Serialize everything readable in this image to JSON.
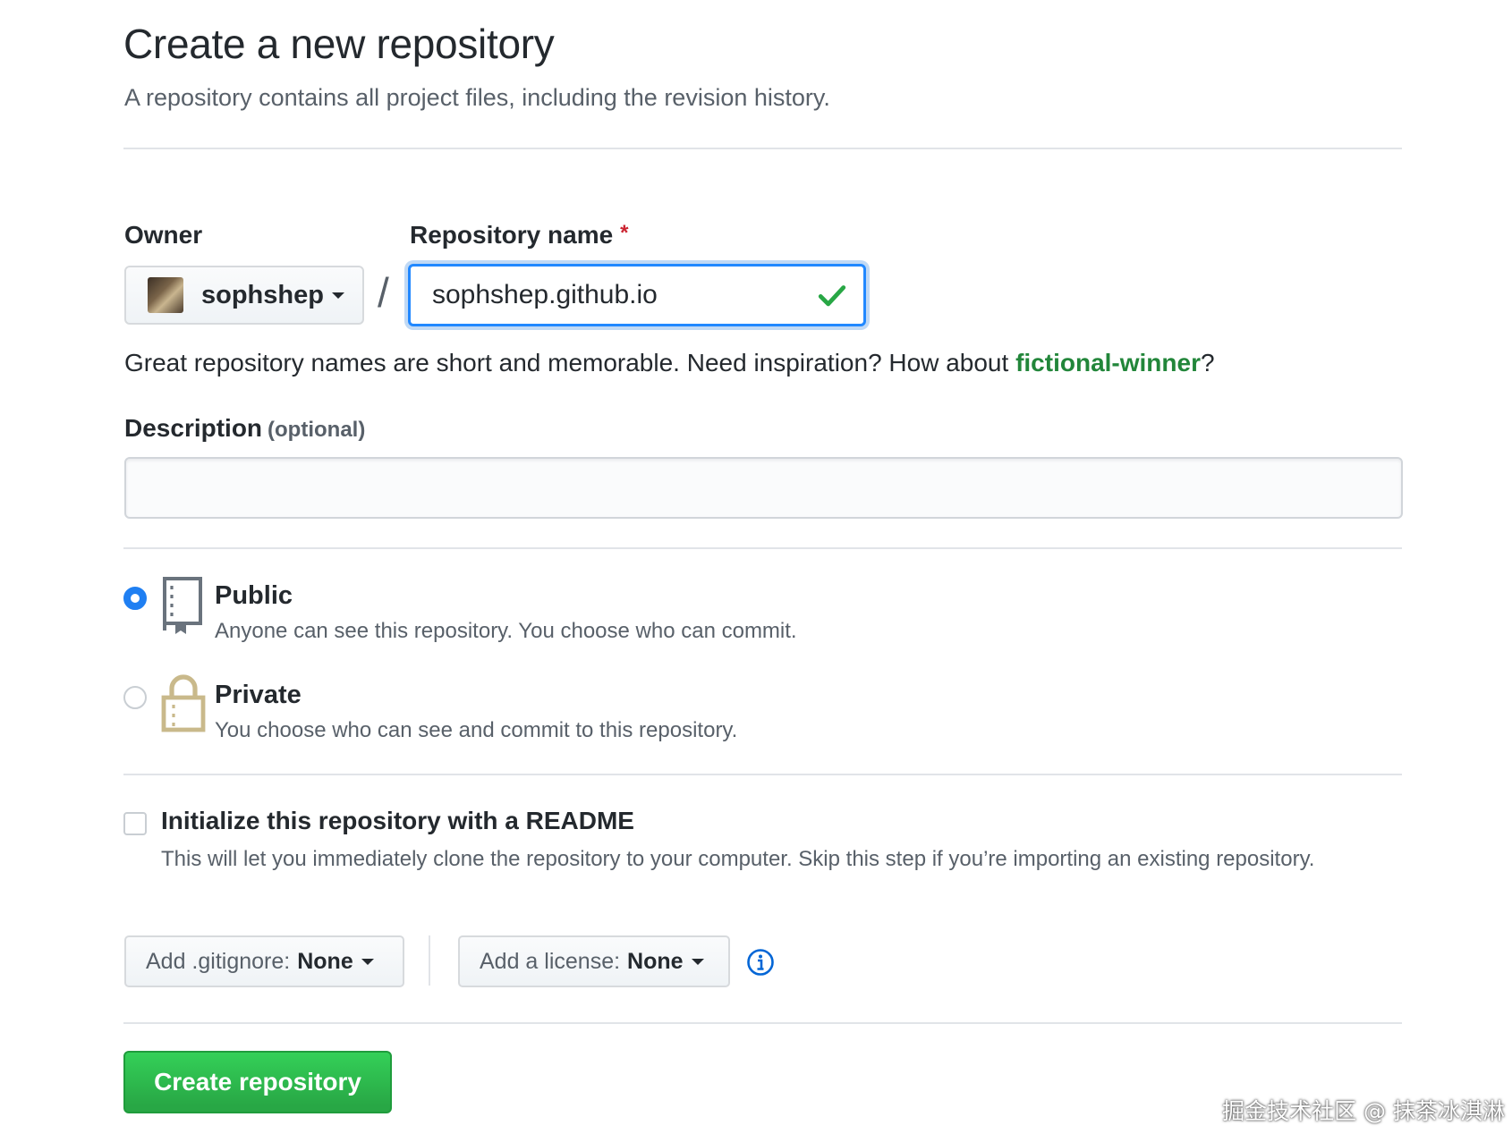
{
  "header": {
    "title": "Create a new repository",
    "subtitle": "A repository contains all project files, including the revision history."
  },
  "owner": {
    "label": "Owner",
    "value": "sophshep"
  },
  "repo_name": {
    "label": "Repository name",
    "required_mark": "*",
    "value": "sophshep.github.io",
    "separator": "/"
  },
  "hint": {
    "text": "Great repository names are short and memorable. Need inspiration? How about ",
    "suggestion": "fictional-winner",
    "suffix": "?"
  },
  "description": {
    "label": "Description",
    "optional": "(optional)",
    "value": ""
  },
  "visibility": {
    "selected": "public",
    "public": {
      "title": "Public",
      "desc": "Anyone can see this repository. You choose who can commit."
    },
    "private": {
      "title": "Private",
      "desc": "You choose who can see and commit to this repository."
    }
  },
  "readme": {
    "checked": false,
    "title": "Initialize this repository with a README",
    "desc": "This will let you immediately clone the repository to your computer. Skip this step if you’re importing an existing repository."
  },
  "gitignore": {
    "prefix": "Add .gitignore:",
    "value": "None"
  },
  "license": {
    "prefix": "Add a license:",
    "value": "None"
  },
  "submit": {
    "label": "Create repository"
  },
  "watermark": "掘金技术社区 @ 抹茶冰淇淋",
  "colors": {
    "accent_blue": "#2188ff",
    "success_green": "#28a745",
    "link_green": "#22863a",
    "required_red": "#cb2431"
  }
}
